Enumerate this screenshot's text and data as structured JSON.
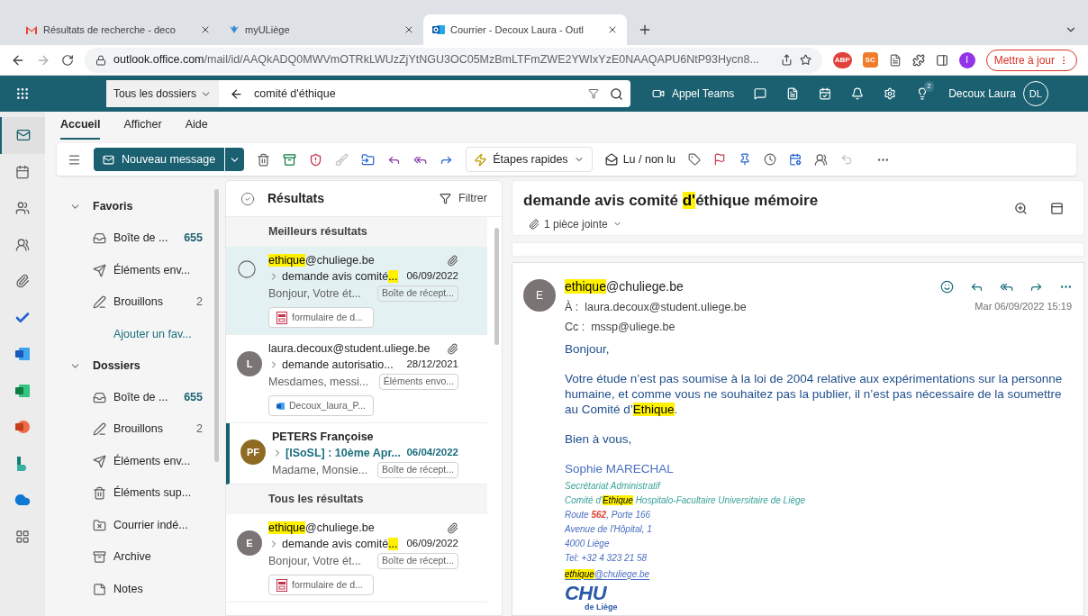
{
  "browser": {
    "tabs": [
      {
        "title": "Résultats de recherche - deco",
        "kind": "gmail",
        "selected": false
      },
      {
        "title": "myULiège",
        "kind": "uliege",
        "selected": false
      },
      {
        "title": "Courrier - Decoux Laura - Outl",
        "kind": "outlook",
        "selected": true
      }
    ],
    "address": {
      "host": "outlook.office.com",
      "path": "/mail/id/AAQkADQ0MWVmOTRkLWUzZjYtNGU3OC05MzBmLTFmZWE2YWIxYzE0NAAQAPU6NtP93Hycn8..."
    },
    "extensions": [
      "ABP",
      "SC"
    ],
    "profile": "I",
    "update_button": "Mettre à jour"
  },
  "header": {
    "scope": "Tous les dossiers",
    "search": "comité d'éthique",
    "teams_button": "Appel Teams",
    "tips_badge": "2",
    "user_name": "Decoux Laura",
    "user_initials": "DL"
  },
  "rail": [
    {
      "kind": "mail",
      "selected": true
    },
    {
      "kind": "calendar",
      "selected": false
    },
    {
      "kind": "people",
      "selected": false
    },
    {
      "kind": "groups",
      "selected": false
    },
    {
      "kind": "attach",
      "selected": false
    },
    {
      "kind": "todo",
      "selected": false
    },
    {
      "kind": "word",
      "selected": false
    },
    {
      "kind": "excel",
      "selected": false
    },
    {
      "kind": "powerpoint",
      "selected": false
    },
    {
      "kind": "bookings",
      "selected": false
    },
    {
      "kind": "onedrive",
      "selected": false
    },
    {
      "kind": "apps",
      "selected": false
    }
  ],
  "ribbon_tabs": [
    {
      "label": "Accueil",
      "selected": true
    },
    {
      "label": "Afficher",
      "selected": false
    },
    {
      "label": "Aide",
      "selected": false
    }
  ],
  "toolbar": {
    "new_message": "Nouveau message",
    "quick_steps": "Étapes rapides",
    "read_unread": "Lu / non lu"
  },
  "folders": [
    {
      "title": "Favoris",
      "expanded": true,
      "items": [
        {
          "kind": "inbox",
          "label": "Boîte de ...",
          "count": "655",
          "unread": true
        },
        {
          "kind": "sent",
          "label": "Éléments env..."
        },
        {
          "kind": "drafts",
          "label": "Brouillons",
          "count": "2",
          "unread": false
        }
      ],
      "add_link": "Ajouter un fav..."
    },
    {
      "title": "Dossiers",
      "expanded": true,
      "items": [
        {
          "kind": "inbox",
          "label": "Boîte de ...",
          "count": "655",
          "unread": true
        },
        {
          "kind": "drafts",
          "label": "Brouillons",
          "count": "2",
          "unread": false
        },
        {
          "kind": "sent",
          "label": "Éléments env..."
        },
        {
          "kind": "deleted",
          "label": "Éléments sup..."
        },
        {
          "kind": "junk",
          "label": "Courrier indé..."
        },
        {
          "kind": "archive",
          "label": "Archive"
        },
        {
          "kind": "notes",
          "label": "Notes"
        }
      ]
    }
  ],
  "results": {
    "title": "Résultats",
    "filter": "Filtrer",
    "groups": [
      {
        "title": "Meilleurs résultats",
        "messages": [
          {
            "selected": true,
            "unread": false,
            "from": [
              {
                "text": "ethique",
                "highlighted": true
              },
              {
                "text": "@chuliege.be"
              }
            ],
            "subject": [
              {
                "text": "demande avis comité"
              },
              {
                "text": "...",
                "highlighted": true
              }
            ],
            "date": "06/09/2022",
            "preview": "Bonjour, Votre ét...",
            "folder": "Boîte de récept...",
            "attachment": {
              "kind": "pdf",
              "name": "formulaire de d..."
            }
          },
          {
            "selected": false,
            "unread": false,
            "avatar": {
              "initials": "L",
              "color": "#7a7574"
            },
            "from": [
              {
                "text": "laura.decoux@student.uliege.be"
              }
            ],
            "subject": [
              {
                "text": "demande autorisatio..."
              }
            ],
            "date": "28/12/2021",
            "preview": "Mesdames, messi...",
            "folder": "Éléments envo...",
            "attachment": {
              "kind": "word",
              "name": "Decoux_laura_P..."
            }
          },
          {
            "selected": false,
            "unread": true,
            "avatar": {
              "initials": "PF",
              "color": "#8e6a23"
            },
            "from": [
              {
                "text": "PETERS Françoise"
              }
            ],
            "subject": [
              {
                "text": "[ISoSL] : 10ème Apr..."
              }
            ],
            "date": "06/04/2022",
            "preview": "Madame, Monsie...",
            "folder": "Boîte de récept..."
          }
        ]
      },
      {
        "title": "Tous les résultats",
        "messages": [
          {
            "selected": false,
            "unread": false,
            "avatar": {
              "initials": "E",
              "color": "#7a7574"
            },
            "from": [
              {
                "text": "ethique",
                "highlighted": true
              },
              {
                "text": "@chuliege.be"
              }
            ],
            "subject": [
              {
                "text": "demande avis comité"
              },
              {
                "text": "...",
                "highlighted": true
              }
            ],
            "date": "06/09/2022",
            "preview": "Bonjour, Votre ét...",
            "folder": "Boîte de récept...",
            "attachment": {
              "kind": "pdf",
              "name": "formulaire de d..."
            }
          }
        ]
      }
    ]
  },
  "reading": {
    "subject": [
      {
        "text": "demande avis comité "
      },
      {
        "text": "d'",
        "highlighted": true
      },
      {
        "text": "éthique mémoire"
      }
    ],
    "attachments_label": "1 pièce jointe",
    "message": {
      "avatar": "E",
      "from": [
        {
          "text": "ethique",
          "highlighted": true
        },
        {
          "text": "@chuliege.be"
        }
      ],
      "to_label": "À :",
      "to": "laura.decoux@student.uliege.be",
      "cc_label": "Cc :",
      "cc": "mssp@uliege.be",
      "date": "Mar 06/09/2022 15:19",
      "body": [
        [
          {
            "text": "Bonjour,"
          }
        ],
        [
          {
            "text": "Votre étude n’est pas soumise à la loi de 2004 relative aux expérimentations sur la personne humaine, et comme vous ne souhaitez pas la publier, il n’est pas nécessaire de la soumettre au Comité d’"
          },
          {
            "text": "Ethique",
            "highlighted": true
          },
          {
            "text": "."
          }
        ],
        [
          {
            "text": "Bien à vous,"
          }
        ]
      ],
      "signature_name": "Sophie MARECHAL",
      "signature": [
        {
          "color": "#3aa39a",
          "segments": [
            {
              "text": "Secrétariat Administratif"
            }
          ]
        },
        {
          "color": "#3aa39a",
          "segments": [
            {
              "text": "Comité d'"
            },
            {
              "text": "Ethique",
              "highlighted": true
            },
            {
              "text": " Hospitalo-Facultaire Universitaire de Liège"
            }
          ]
        },
        {
          "color": "#4a6fc1",
          "segments": [
            {
              "text": "Route "
            },
            {
              "text": "562",
              "color": "#e03c31"
            },
            {
              "text": ", Porte 166"
            }
          ]
        },
        {
          "color": "#4a6fc1",
          "segments": [
            {
              "text": "Avenue de l'Hôpital, 1"
            }
          ]
        },
        {
          "color": "#4a6fc1",
          "segments": [
            {
              "text": "4000 Liège"
            }
          ]
        },
        {
          "color": "#4a6fc1",
          "segments": [
            {
              "text": "Tel: +32 4 323 21 58"
            }
          ]
        }
      ],
      "signature_email": [
        {
          "text": "ethique",
          "highlighted": true
        },
        {
          "text": "@chuliege.be"
        }
      ],
      "logo": {
        "text": "CHU",
        "subtitle": "de Liège"
      }
    }
  }
}
